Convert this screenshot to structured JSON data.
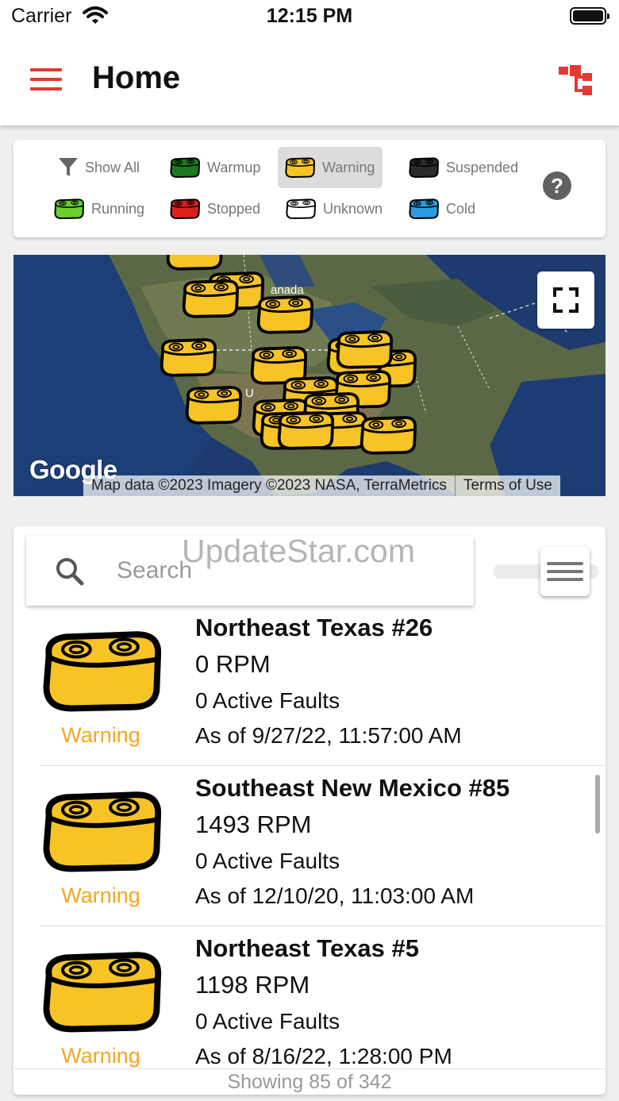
{
  "status_bar": {
    "carrier": "Carrier",
    "time": "12:15 PM"
  },
  "header": {
    "title": "Home"
  },
  "legend": {
    "items": [
      {
        "label": "Show All",
        "icon": "filter-icon"
      },
      {
        "label": "Warmup",
        "icon": "engine-warmup-icon",
        "color": "#1b7a1e"
      },
      {
        "label": "Warning",
        "icon": "engine-warning-icon",
        "color": "#f7c325",
        "active": true
      },
      {
        "label": "Suspended",
        "icon": "engine-suspended-icon",
        "color": "#2b2b2b"
      },
      {
        "label": "Running",
        "icon": "engine-running-icon",
        "color": "#6ccf2c"
      },
      {
        "label": "Stopped",
        "icon": "engine-stopped-icon",
        "color": "#e01e1e"
      },
      {
        "label": "Unknown",
        "icon": "engine-unknown-icon",
        "color": "#ffffff"
      },
      {
        "label": "Cold",
        "icon": "engine-cold-icon",
        "color": "#2a9de0"
      }
    ],
    "help": "?"
  },
  "map": {
    "label_canada": "anada",
    "label_us": "U",
    "google_logo": "Google",
    "attribution": "Map data ©2023 Imagery ©2023 NASA, TerraMetrics",
    "terms": "Terms of Use"
  },
  "search": {
    "placeholder": "Search",
    "value": ""
  },
  "watermark": "UpdateStar.com",
  "list": {
    "items": [
      {
        "name": "Northeast Texas #26",
        "rpm": "0 RPM",
        "faults": "0 Active Faults",
        "as_of": "As of 9/27/22, 11:57:00 AM",
        "status": "Warning"
      },
      {
        "name": "Southeast New Mexico #85",
        "rpm": "1493 RPM",
        "faults": "0 Active Faults",
        "as_of": "As of 12/10/20, 11:03:00 AM",
        "status": "Warning"
      },
      {
        "name": "Northeast Texas #5",
        "rpm": "1198 RPM",
        "faults": "0 Active Faults",
        "as_of": "As of 8/16/22, 1:28:00 PM",
        "status": "Warning"
      }
    ],
    "footer": "Showing 85 of 342"
  },
  "colors": {
    "accent": "#e53935",
    "warning": "#f5a623",
    "engine_yellow": "#f7c325"
  }
}
